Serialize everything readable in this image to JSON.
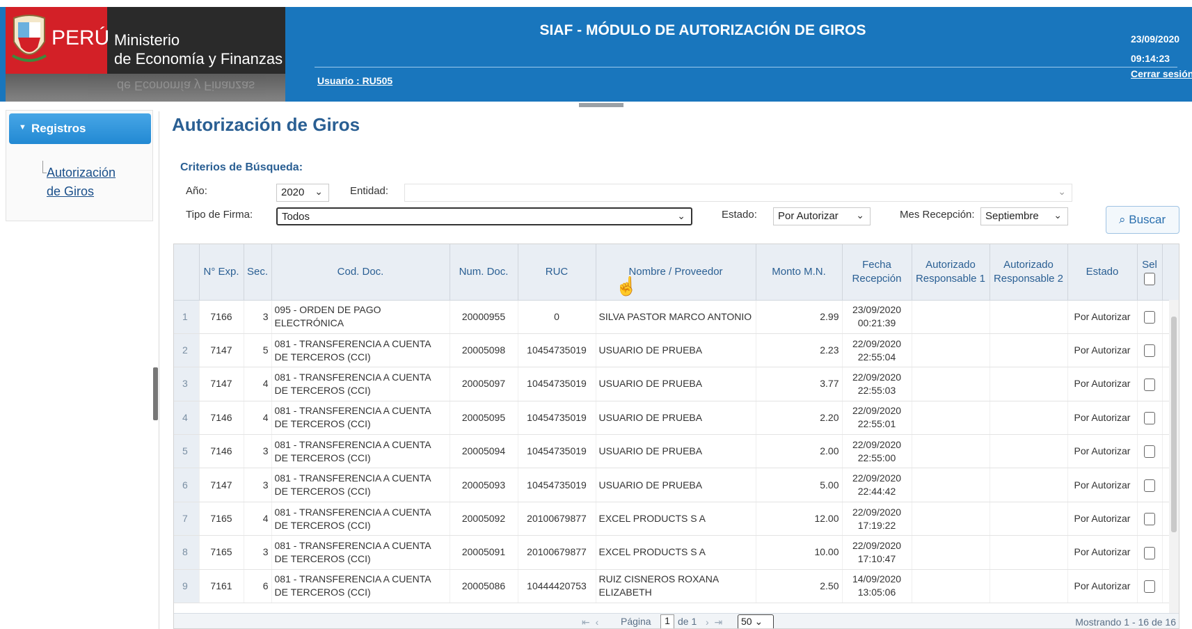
{
  "header": {
    "peru": "PERÚ",
    "ministry_line1": "Ministerio",
    "ministry_line2": "de Economía y Finanzas",
    "module_title": "SIAF - MÓDULO DE AUTORIZACIÓN DE GIROS",
    "user": "Usuario : RU505",
    "date": "23/09/2020",
    "time": "09:14:23",
    "logout": "Cerrar sesión"
  },
  "sidebar": {
    "section": "Registros",
    "link_line1": "Autorización",
    "link_line2": "de Giros"
  },
  "main": {
    "title": "Autorización de Giros",
    "criteria": "Criterios de Búsqueda:",
    "year_label": "Año:",
    "year_value": "2020",
    "entity_label": "Entidad:",
    "entity_value": "",
    "signature_label": "Tipo de Firma:",
    "signature_value": "Todos",
    "status_label": "Estado:",
    "status_value": "Por Autorizar",
    "month_label": "Mes Recepción:",
    "month_value": "Septiembre",
    "search_button": "Buscar"
  },
  "grid": {
    "headers": [
      "N° Exp.",
      "Sec.",
      "Cod. Doc.",
      "Num. Doc.",
      "RUC",
      "Nombre / Proveedor",
      "Monto M.N.",
      "Fecha Recepción",
      "Autorizado Responsable 1",
      "Autorizado Responsable 2",
      "Estado",
      "Sel"
    ],
    "rows": [
      {
        "n": "1",
        "exp": "7166",
        "sec": "3",
        "cod": "095 - ORDEN DE PAGO ELECTRÓNICA",
        "num": "20000955",
        "ruc": "0",
        "name": "SILVA PASTOR MARCO ANTONIO",
        "monto": "2.99",
        "fecha": "23/09/2020",
        "hora": "00:21:39",
        "estado": "Por Autorizar"
      },
      {
        "n": "2",
        "exp": "7147",
        "sec": "5",
        "cod": "081 - TRANSFERENCIA A CUENTA DE TERCEROS (CCI)",
        "num": "20005098",
        "ruc": "10454735019",
        "name": "USUARIO DE PRUEBA",
        "monto": "2.23",
        "fecha": "22/09/2020",
        "hora": "22:55:04",
        "estado": "Por Autorizar"
      },
      {
        "n": "3",
        "exp": "7147",
        "sec": "4",
        "cod": "081 - TRANSFERENCIA A CUENTA DE TERCEROS (CCI)",
        "num": "20005097",
        "ruc": "10454735019",
        "name": "USUARIO DE PRUEBA",
        "monto": "3.77",
        "fecha": "22/09/2020",
        "hora": "22:55:03",
        "estado": "Por Autorizar"
      },
      {
        "n": "4",
        "exp": "7146",
        "sec": "4",
        "cod": "081 - TRANSFERENCIA A CUENTA DE TERCEROS (CCI)",
        "num": "20005095",
        "ruc": "10454735019",
        "name": "USUARIO DE PRUEBA",
        "monto": "2.20",
        "fecha": "22/09/2020",
        "hora": "22:55:01",
        "estado": "Por Autorizar"
      },
      {
        "n": "5",
        "exp": "7146",
        "sec": "3",
        "cod": "081 - TRANSFERENCIA A CUENTA DE TERCEROS (CCI)",
        "num": "20005094",
        "ruc": "10454735019",
        "name": "USUARIO DE PRUEBA",
        "monto": "2.00",
        "fecha": "22/09/2020",
        "hora": "22:55:00",
        "estado": "Por Autorizar"
      },
      {
        "n": "6",
        "exp": "7147",
        "sec": "3",
        "cod": "081 - TRANSFERENCIA A CUENTA DE TERCEROS (CCI)",
        "num": "20005093",
        "ruc": "10454735019",
        "name": "USUARIO DE PRUEBA",
        "monto": "5.00",
        "fecha": "22/09/2020",
        "hora": "22:44:42",
        "estado": "Por Autorizar"
      },
      {
        "n": "7",
        "exp": "7165",
        "sec": "4",
        "cod": "081 - TRANSFERENCIA A CUENTA DE TERCEROS (CCI)",
        "num": "20005092",
        "ruc": "20100679877",
        "name": "EXCEL PRODUCTS S A",
        "monto": "12.00",
        "fecha": "22/09/2020",
        "hora": "17:19:22",
        "estado": "Por Autorizar"
      },
      {
        "n": "8",
        "exp": "7165",
        "sec": "3",
        "cod": "081 - TRANSFERENCIA A CUENTA DE TERCEROS (CCI)",
        "num": "20005091",
        "ruc": "20100679877",
        "name": "EXCEL PRODUCTS S A",
        "monto": "10.00",
        "fecha": "22/09/2020",
        "hora": "17:10:47",
        "estado": "Por Autorizar"
      },
      {
        "n": "9",
        "exp": "7161",
        "sec": "6",
        "cod": "081 - TRANSFERENCIA A CUENTA DE TERCEROS (CCI)",
        "num": "20005086",
        "ruc": "10444420753",
        "name": "RUIZ CISNEROS ROXANA ELIZABETH",
        "monto": "2.50",
        "fecha": "14/09/2020",
        "hora": "13:05:06",
        "estado": "Por Autorizar"
      }
    ]
  },
  "pager": {
    "page_label": "Página",
    "page_value": "1",
    "of_label": "de 1",
    "page_size": "50",
    "showing": "Mostrando 1 - 16 de 16"
  },
  "colors": {
    "header_blue": "#1976bd",
    "peru_red": "#d32027",
    "title_blue": "#2a5f93"
  }
}
